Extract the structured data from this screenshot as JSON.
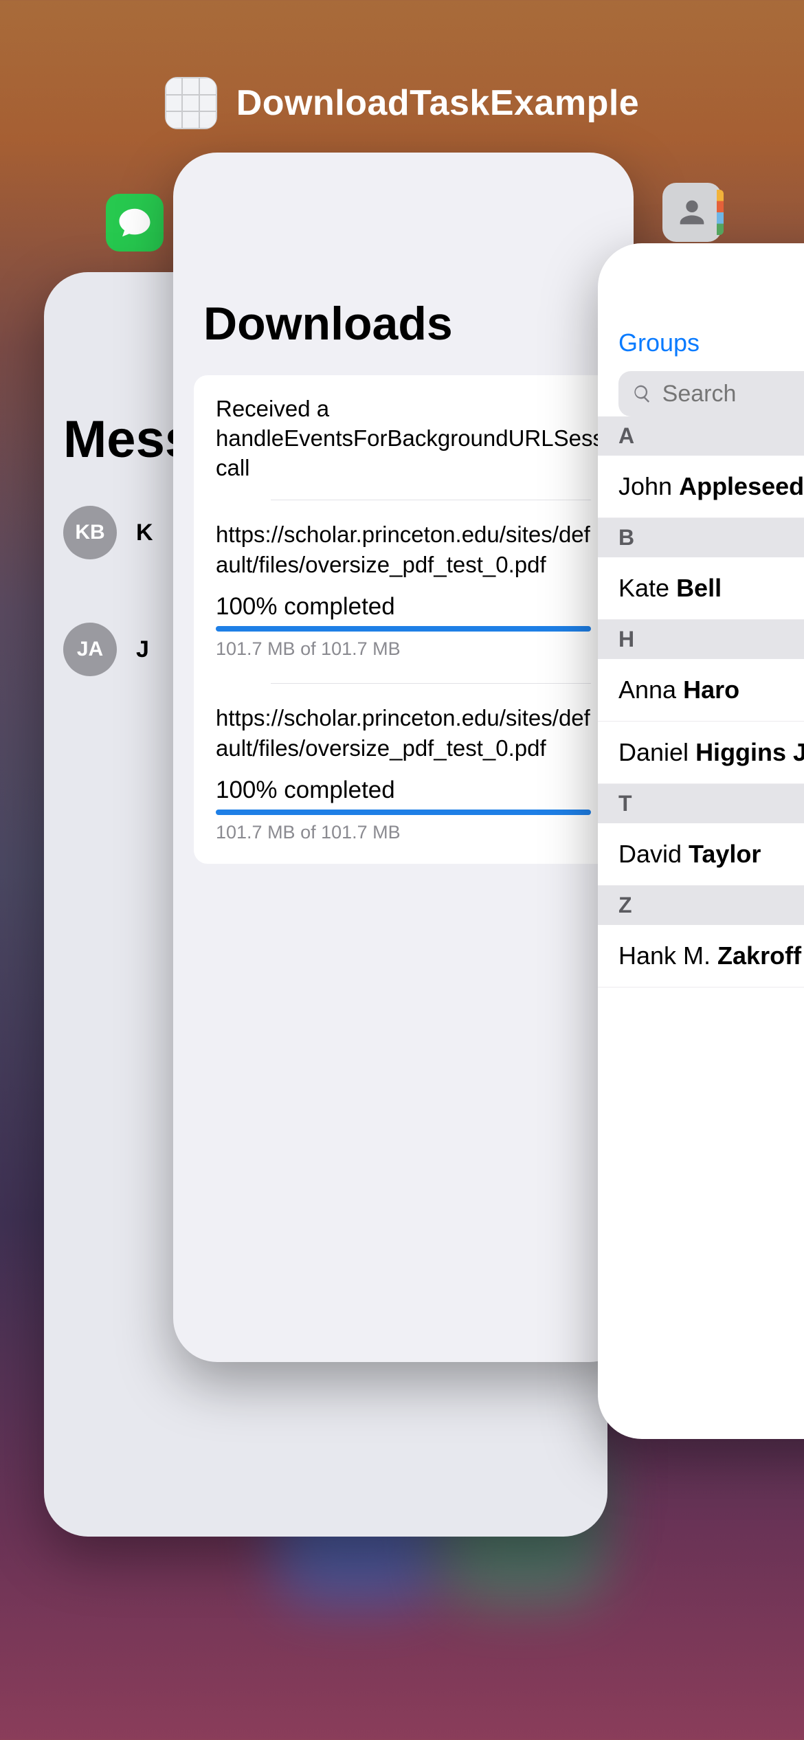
{
  "header": {
    "app_name": "DownloadTaskExample"
  },
  "messages": {
    "title": "Messages",
    "rows": [
      {
        "initials": "KB",
        "name": "K"
      },
      {
        "initials": "JA",
        "name": "J"
      }
    ]
  },
  "downloads": {
    "title": "Downloads",
    "note": "Received a handleEventsForBackgroundURLSession call",
    "items": [
      {
        "url": "https://scholar.princeton.edu/sites/default/files/oversize_pdf_test_0.pdf",
        "pct": "100% completed",
        "size": "101.7 MB of 101.7 MB"
      },
      {
        "url": "https://scholar.princeton.edu/sites/default/files/oversize_pdf_test_0.pdf",
        "pct": "100% completed",
        "size": "101.7 MB of 101.7 MB"
      }
    ]
  },
  "contacts": {
    "groups_label": "Groups",
    "search_placeholder": "Search",
    "sections": [
      {
        "letter": "A",
        "people": [
          {
            "first": "John",
            "last": "Appleseed"
          }
        ]
      },
      {
        "letter": "B",
        "people": [
          {
            "first": "Kate",
            "last": "Bell"
          }
        ]
      },
      {
        "letter": "H",
        "people": [
          {
            "first": "Anna",
            "last": "Haro"
          },
          {
            "first": "Daniel",
            "last": "Higgins Jr."
          }
        ]
      },
      {
        "letter": "T",
        "people": [
          {
            "first": "David",
            "last": "Taylor"
          }
        ]
      },
      {
        "letter": "Z",
        "people": [
          {
            "first": "Hank M.",
            "last": "Zakroff"
          }
        ]
      }
    ]
  }
}
